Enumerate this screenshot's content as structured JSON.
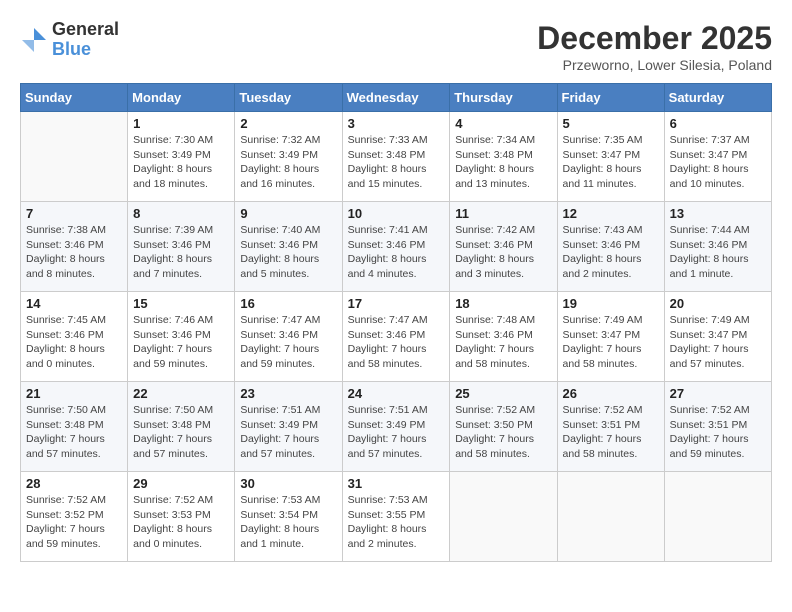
{
  "logo": {
    "general": "General",
    "blue": "Blue"
  },
  "title": "December 2025",
  "location": "Przeworno, Lower Silesia, Poland",
  "days_header": [
    "Sunday",
    "Monday",
    "Tuesday",
    "Wednesday",
    "Thursday",
    "Friday",
    "Saturday"
  ],
  "weeks": [
    [
      {
        "day": "",
        "info": ""
      },
      {
        "day": "1",
        "info": "Sunrise: 7:30 AM\nSunset: 3:49 PM\nDaylight: 8 hours\nand 18 minutes."
      },
      {
        "day": "2",
        "info": "Sunrise: 7:32 AM\nSunset: 3:49 PM\nDaylight: 8 hours\nand 16 minutes."
      },
      {
        "day": "3",
        "info": "Sunrise: 7:33 AM\nSunset: 3:48 PM\nDaylight: 8 hours\nand 15 minutes."
      },
      {
        "day": "4",
        "info": "Sunrise: 7:34 AM\nSunset: 3:48 PM\nDaylight: 8 hours\nand 13 minutes."
      },
      {
        "day": "5",
        "info": "Sunrise: 7:35 AM\nSunset: 3:47 PM\nDaylight: 8 hours\nand 11 minutes."
      },
      {
        "day": "6",
        "info": "Sunrise: 7:37 AM\nSunset: 3:47 PM\nDaylight: 8 hours\nand 10 minutes."
      }
    ],
    [
      {
        "day": "7",
        "info": "Sunrise: 7:38 AM\nSunset: 3:46 PM\nDaylight: 8 hours\nand 8 minutes."
      },
      {
        "day": "8",
        "info": "Sunrise: 7:39 AM\nSunset: 3:46 PM\nDaylight: 8 hours\nand 7 minutes."
      },
      {
        "day": "9",
        "info": "Sunrise: 7:40 AM\nSunset: 3:46 PM\nDaylight: 8 hours\nand 5 minutes."
      },
      {
        "day": "10",
        "info": "Sunrise: 7:41 AM\nSunset: 3:46 PM\nDaylight: 8 hours\nand 4 minutes."
      },
      {
        "day": "11",
        "info": "Sunrise: 7:42 AM\nSunset: 3:46 PM\nDaylight: 8 hours\nand 3 minutes."
      },
      {
        "day": "12",
        "info": "Sunrise: 7:43 AM\nSunset: 3:46 PM\nDaylight: 8 hours\nand 2 minutes."
      },
      {
        "day": "13",
        "info": "Sunrise: 7:44 AM\nSunset: 3:46 PM\nDaylight: 8 hours\nand 1 minute."
      }
    ],
    [
      {
        "day": "14",
        "info": "Sunrise: 7:45 AM\nSunset: 3:46 PM\nDaylight: 8 hours\nand 0 minutes."
      },
      {
        "day": "15",
        "info": "Sunrise: 7:46 AM\nSunset: 3:46 PM\nDaylight: 7 hours\nand 59 minutes."
      },
      {
        "day": "16",
        "info": "Sunrise: 7:47 AM\nSunset: 3:46 PM\nDaylight: 7 hours\nand 59 minutes."
      },
      {
        "day": "17",
        "info": "Sunrise: 7:47 AM\nSunset: 3:46 PM\nDaylight: 7 hours\nand 58 minutes."
      },
      {
        "day": "18",
        "info": "Sunrise: 7:48 AM\nSunset: 3:46 PM\nDaylight: 7 hours\nand 58 minutes."
      },
      {
        "day": "19",
        "info": "Sunrise: 7:49 AM\nSunset: 3:47 PM\nDaylight: 7 hours\nand 58 minutes."
      },
      {
        "day": "20",
        "info": "Sunrise: 7:49 AM\nSunset: 3:47 PM\nDaylight: 7 hours\nand 57 minutes."
      }
    ],
    [
      {
        "day": "21",
        "info": "Sunrise: 7:50 AM\nSunset: 3:48 PM\nDaylight: 7 hours\nand 57 minutes."
      },
      {
        "day": "22",
        "info": "Sunrise: 7:50 AM\nSunset: 3:48 PM\nDaylight: 7 hours\nand 57 minutes."
      },
      {
        "day": "23",
        "info": "Sunrise: 7:51 AM\nSunset: 3:49 PM\nDaylight: 7 hours\nand 57 minutes."
      },
      {
        "day": "24",
        "info": "Sunrise: 7:51 AM\nSunset: 3:49 PM\nDaylight: 7 hours\nand 57 minutes."
      },
      {
        "day": "25",
        "info": "Sunrise: 7:52 AM\nSunset: 3:50 PM\nDaylight: 7 hours\nand 58 minutes."
      },
      {
        "day": "26",
        "info": "Sunrise: 7:52 AM\nSunset: 3:51 PM\nDaylight: 7 hours\nand 58 minutes."
      },
      {
        "day": "27",
        "info": "Sunrise: 7:52 AM\nSunset: 3:51 PM\nDaylight: 7 hours\nand 59 minutes."
      }
    ],
    [
      {
        "day": "28",
        "info": "Sunrise: 7:52 AM\nSunset: 3:52 PM\nDaylight: 7 hours\nand 59 minutes."
      },
      {
        "day": "29",
        "info": "Sunrise: 7:52 AM\nSunset: 3:53 PM\nDaylight: 8 hours\nand 0 minutes."
      },
      {
        "day": "30",
        "info": "Sunrise: 7:53 AM\nSunset: 3:54 PM\nDaylight: 8 hours\nand 1 minute."
      },
      {
        "day": "31",
        "info": "Sunrise: 7:53 AM\nSunset: 3:55 PM\nDaylight: 8 hours\nand 2 minutes."
      },
      {
        "day": "",
        "info": ""
      },
      {
        "day": "",
        "info": ""
      },
      {
        "day": "",
        "info": ""
      }
    ]
  ]
}
